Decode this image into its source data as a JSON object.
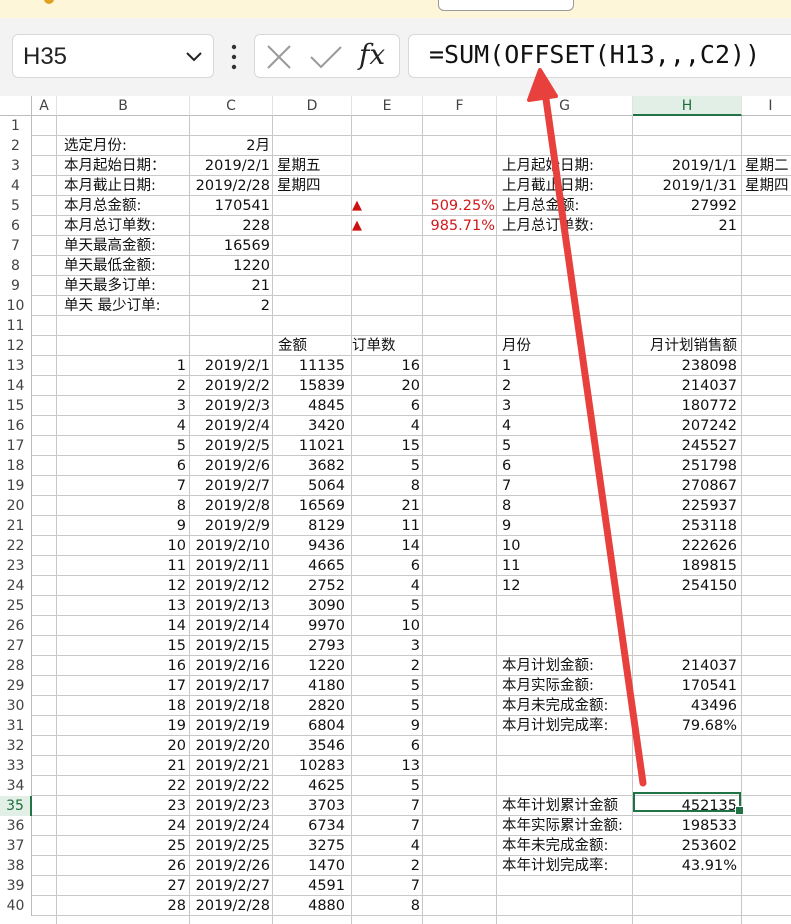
{
  "formula_bar": {
    "name_box": "H35",
    "fx_label": "fx",
    "formula": "=SUM(OFFSET(H13,,,C2))"
  },
  "columns": [
    "A",
    "B",
    "C",
    "D",
    "E",
    "F",
    "G",
    "H",
    "I"
  ],
  "selected_column": "H",
  "selected_row": 35,
  "rows": [
    1,
    2,
    3,
    4,
    5,
    6,
    7,
    8,
    9,
    10,
    11,
    12,
    13,
    14,
    15,
    16,
    17,
    18,
    19,
    20,
    21,
    22,
    23,
    24,
    25,
    26,
    27,
    28,
    29,
    30,
    31,
    32,
    33,
    34,
    35,
    36,
    37,
    38,
    39,
    40
  ],
  "summary_labels": [
    "选定月份:",
    "本月起始日期：",
    "本月截止日期:",
    "本月总金额:",
    "本月总订单数:",
    "单天最高金额:",
    "单天最低金额:",
    "单天最多订单:",
    "单天 最少订单:"
  ],
  "summary_values": [
    "2月",
    "2019/2/1",
    "2019/2/28",
    "170541",
    "228",
    "16569",
    "1220",
    "21",
    "2"
  ],
  "weekday_current": [
    "星期五",
    "星期四"
  ],
  "change_marks": [
    {
      "symbol": "▲",
      "pct": "509.25%"
    },
    {
      "symbol": "▲",
      "pct": "985.71%"
    }
  ],
  "prev_labels": [
    "上月起始日期:",
    "上月截止日期:",
    "上月总金额:",
    "上月总订单数:"
  ],
  "prev_values": [
    "2019/1/1",
    "2019/1/31",
    "27992",
    "21"
  ],
  "weekday_prev": [
    "星期二",
    "星期四"
  ],
  "daily_headers": {
    "amount": "金额",
    "orders": "订单数"
  },
  "daily": [
    [
      "1",
      "2019/2/1",
      "11135",
      "16"
    ],
    [
      "2",
      "2019/2/2",
      "15839",
      "20"
    ],
    [
      "3",
      "2019/2/3",
      "4845",
      "6"
    ],
    [
      "4",
      "2019/2/4",
      "3420",
      "4"
    ],
    [
      "5",
      "2019/2/5",
      "11021",
      "15"
    ],
    [
      "6",
      "2019/2/6",
      "3682",
      "5"
    ],
    [
      "7",
      "2019/2/7",
      "5064",
      "8"
    ],
    [
      "8",
      "2019/2/8",
      "16569",
      "21"
    ],
    [
      "9",
      "2019/2/9",
      "8129",
      "11"
    ],
    [
      "10",
      "2019/2/10",
      "9436",
      "14"
    ],
    [
      "11",
      "2019/2/11",
      "4665",
      "6"
    ],
    [
      "12",
      "2019/2/12",
      "2752",
      "4"
    ],
    [
      "13",
      "2019/2/13",
      "3090",
      "5"
    ],
    [
      "14",
      "2019/2/14",
      "9970",
      "10"
    ],
    [
      "15",
      "2019/2/15",
      "2793",
      "3"
    ],
    [
      "16",
      "2019/2/16",
      "1220",
      "2"
    ],
    [
      "17",
      "2019/2/17",
      "4180",
      "5"
    ],
    [
      "18",
      "2019/2/18",
      "2820",
      "5"
    ],
    [
      "19",
      "2019/2/19",
      "6804",
      "9"
    ],
    [
      "20",
      "2019/2/20",
      "3546",
      "6"
    ],
    [
      "21",
      "2019/2/21",
      "10283",
      "13"
    ],
    [
      "22",
      "2019/2/22",
      "4625",
      "5"
    ],
    [
      "23",
      "2019/2/23",
      "3703",
      "7"
    ],
    [
      "24",
      "2019/2/24",
      "6734",
      "7"
    ],
    [
      "25",
      "2019/2/25",
      "3275",
      "4"
    ],
    [
      "26",
      "2019/2/26",
      "1470",
      "2"
    ],
    [
      "27",
      "2019/2/27",
      "4591",
      "7"
    ],
    [
      "28",
      "2019/2/28",
      "4880",
      "8"
    ]
  ],
  "plan_headers": {
    "month": "月份",
    "plan": "月计划销售额"
  },
  "plan": [
    [
      "1",
      "238098"
    ],
    [
      "2",
      "214037"
    ],
    [
      "3",
      "180772"
    ],
    [
      "4",
      "207242"
    ],
    [
      "5",
      "245527"
    ],
    [
      "6",
      "251798"
    ],
    [
      "7",
      "270867"
    ],
    [
      "8",
      "225937"
    ],
    [
      "9",
      "253118"
    ],
    [
      "10",
      "222626"
    ],
    [
      "11",
      "189815"
    ],
    [
      "12",
      "254150"
    ]
  ],
  "month_stats": [
    [
      "本月计划金额:",
      "214037"
    ],
    [
      "本月实际金额:",
      "170541"
    ],
    [
      "本月未完成金额:",
      "43496"
    ],
    [
      "本月计划完成率:",
      "79.68%"
    ]
  ],
  "year_stats": [
    [
      "本年计划累计金额",
      "452135"
    ],
    [
      "本年实际累计金额:",
      "198533"
    ],
    [
      "本年未完成金额:",
      "253602"
    ],
    [
      "本年计划完成率:",
      "43.91%"
    ]
  ],
  "colors": {
    "accent": "#217346",
    "annotation": "#e8403c",
    "negative_red": "#d01a1a"
  }
}
